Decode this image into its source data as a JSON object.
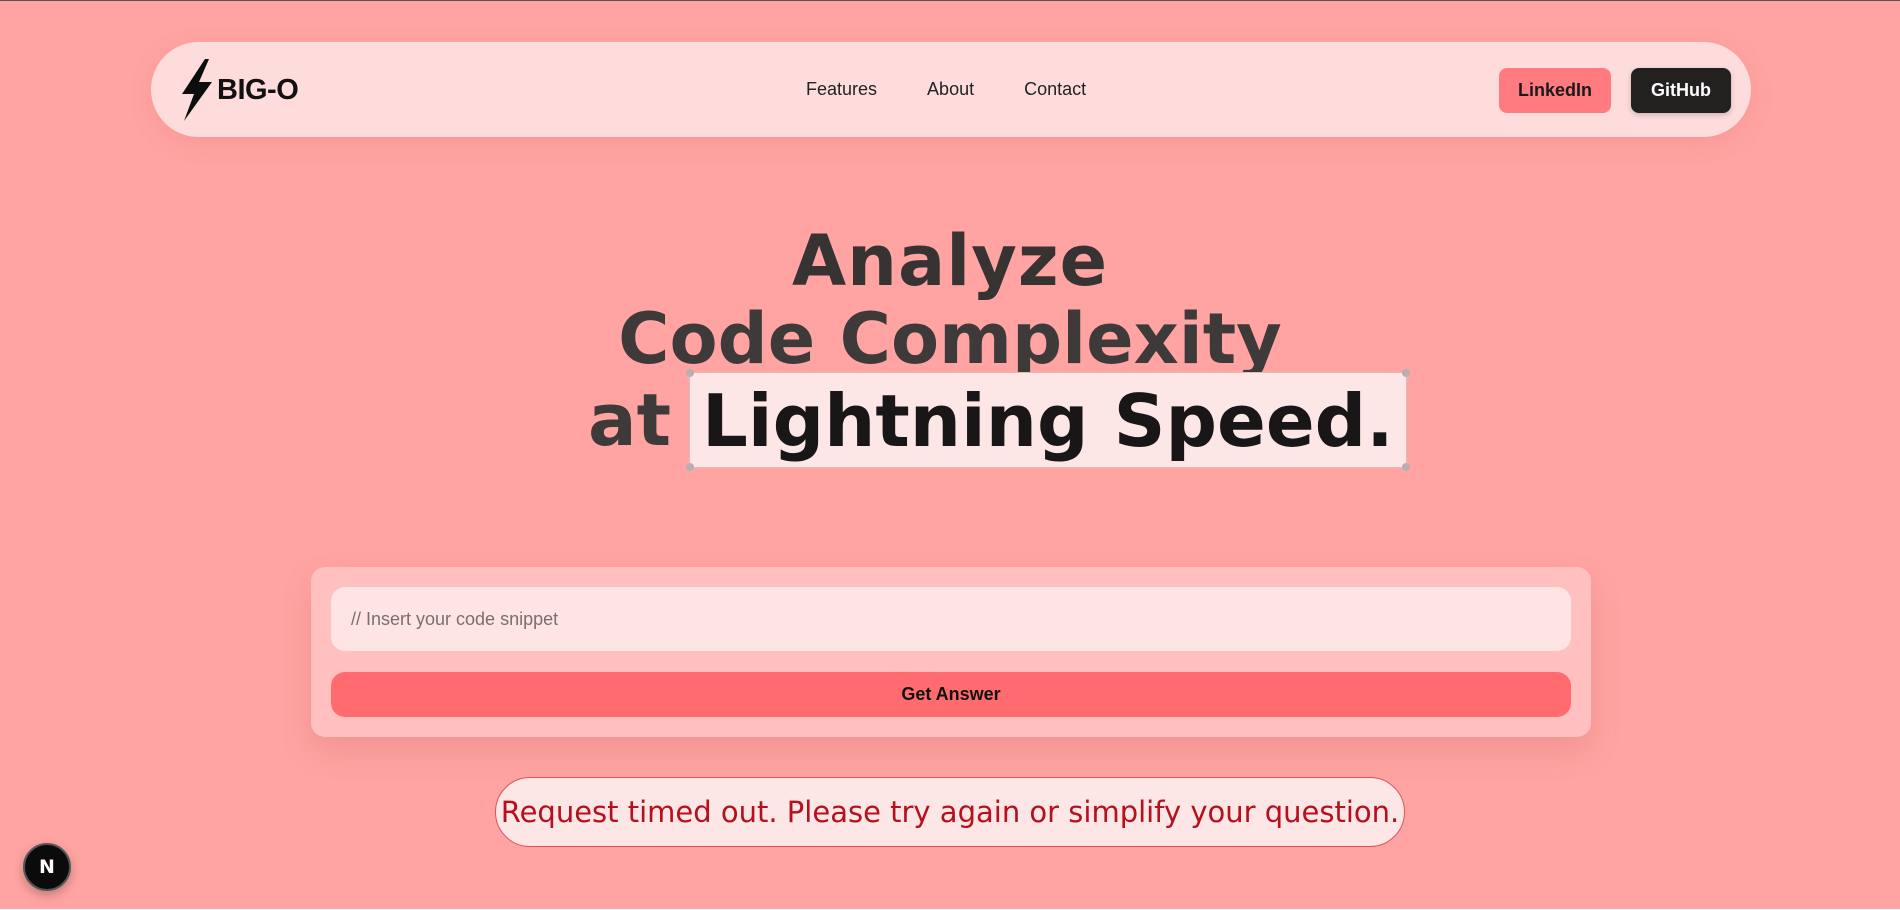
{
  "nav": {
    "logo_text": "BIG-O",
    "logo_icon": "lightning-bolt-icon",
    "links": [
      {
        "label": "Features"
      },
      {
        "label": "About"
      },
      {
        "label": "Contact"
      }
    ],
    "linkedin_label": "LinkedIn",
    "github_label": "GitHub"
  },
  "hero": {
    "line1": "Analyze",
    "line2": "Code Complexity",
    "line3_prefix": "at",
    "line3_highlight": "Lightning Speed."
  },
  "form": {
    "placeholder": "// Insert your code snippet",
    "value": "",
    "submit_label": "Get Answer"
  },
  "error": {
    "message": "Request timed out. Please try again or simplify your question."
  },
  "badge": {
    "letter": "N",
    "icon": "nextjs-icon"
  },
  "colors": {
    "background": "#ffa4a2",
    "nav_bg": "#fedcdc",
    "linkedin_bg": "#ff7b7f",
    "github_bg": "#232020",
    "submit_bg": "#ff6b6e",
    "error_text": "#b5101c"
  }
}
